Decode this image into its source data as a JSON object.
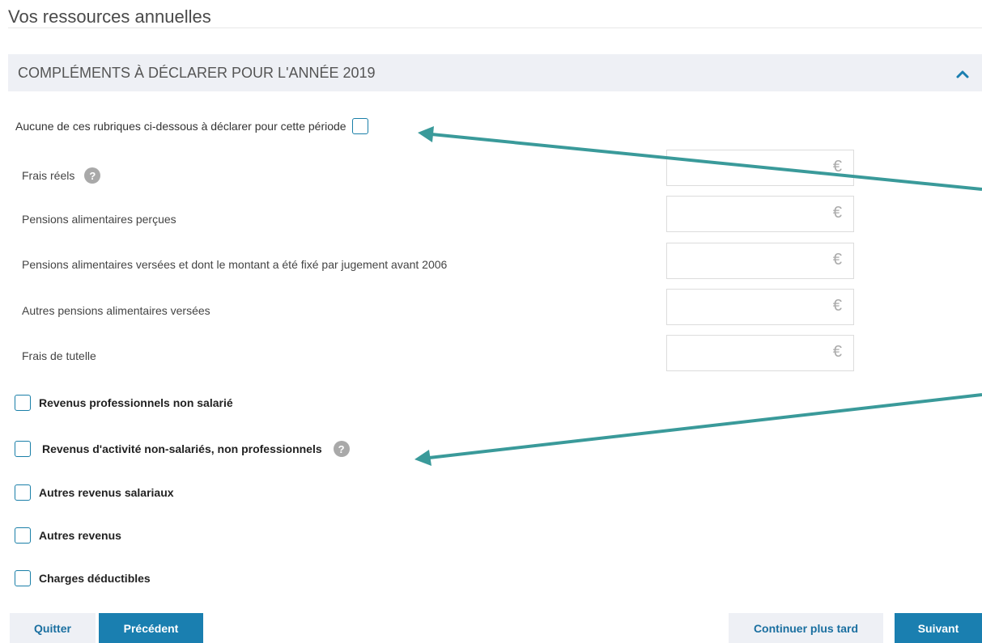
{
  "page": {
    "title": "Vos ressources annuelles"
  },
  "section": {
    "title": "COMPLÉMENTS À DÉCLARER POUR L'ANNÉE 2019",
    "toggle_icon": "chevron-up-icon"
  },
  "none_option": {
    "label": "Aucune de ces rubriques ci-dessous à déclarer pour cette période",
    "checked": false
  },
  "fields": [
    {
      "label": "Frais réels",
      "has_help": true,
      "value": "",
      "unit": "€"
    },
    {
      "label": "Pensions alimentaires perçues",
      "has_help": false,
      "value": "",
      "unit": "€"
    },
    {
      "label": "Pensions alimentaires versées et dont le montant a été fixé par jugement avant 2006",
      "has_help": false,
      "value": "",
      "unit": "€"
    },
    {
      "label": "Autres pensions alimentaires versées",
      "has_help": false,
      "value": "",
      "unit": "€"
    },
    {
      "label": "Frais de tutelle",
      "has_help": false,
      "value": "",
      "unit": "€"
    }
  ],
  "check_items": [
    {
      "label": "Revenus professionnels non salarié",
      "checked": false
    },
    {
      "label": "Revenus d'activité non-salariés, non professionnels",
      "checked": false,
      "has_help": true
    },
    {
      "label": "Autres revenus salariaux",
      "checked": false
    },
    {
      "label": "Autres revenus",
      "checked": false
    },
    {
      "label": "Charges déductibles",
      "checked": false
    }
  ],
  "help_glyph": "?",
  "buttons": {
    "quit": "Quitter",
    "previous": "Précédent",
    "later": "Continuer plus tard",
    "next": "Suivant"
  },
  "colors": {
    "accent": "#1a7fb0",
    "annotation_arrow": "#3a9a9a",
    "header_bg": "#eef0f5"
  }
}
